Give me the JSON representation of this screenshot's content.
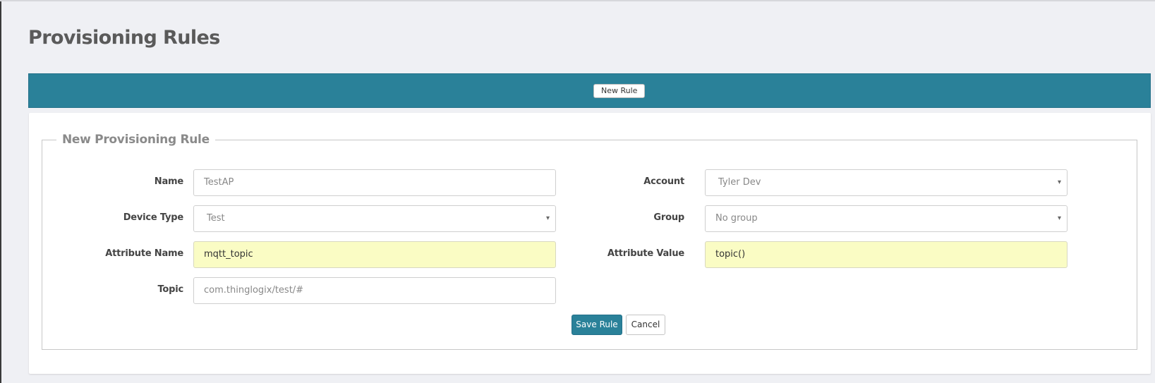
{
  "page": {
    "title": "Provisioning Rules"
  },
  "toolbar": {
    "new_rule_label": "New Rule"
  },
  "form": {
    "legend": "New Provisioning Rule",
    "name": {
      "label": "Name",
      "value": "TestAP"
    },
    "account": {
      "label": "Account",
      "value": "Tyler Dev"
    },
    "device_type": {
      "label": "Device Type",
      "value": "Test"
    },
    "group": {
      "label": "Group",
      "value": "No group"
    },
    "attribute_name": {
      "label": "Attribute Name",
      "value": "mqtt_topic"
    },
    "attribute_value": {
      "label": "Attribute Value",
      "value": "topic()"
    },
    "topic": {
      "label": "Topic",
      "value": "com.thinglogix/test/#"
    },
    "save_label": "Save Rule",
    "cancel_label": "Cancel"
  },
  "icons": {
    "select_caret": "▾"
  },
  "colors": {
    "accent": "#2a8199",
    "page_background": "#eff0f4",
    "highlight_field": "#fafcc4"
  }
}
